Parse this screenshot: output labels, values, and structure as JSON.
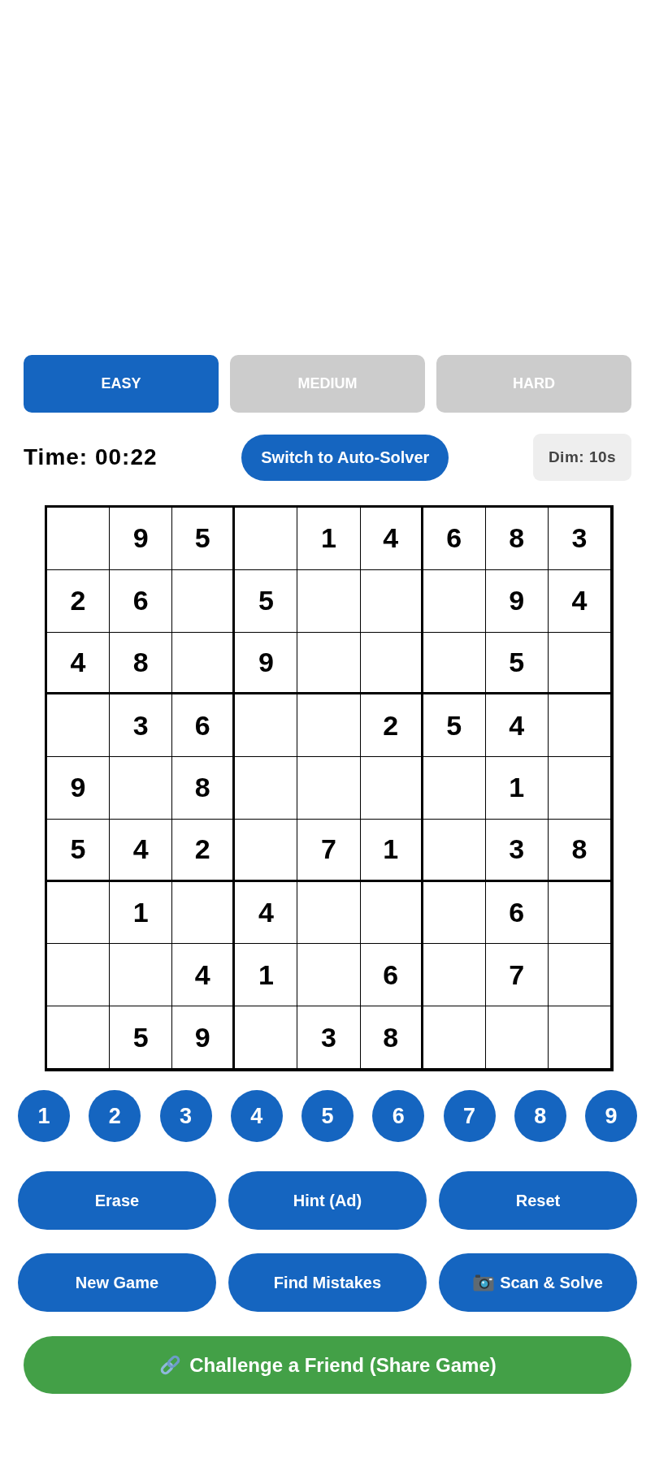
{
  "difficulty_tabs": [
    {
      "label": "EASY",
      "selected": true
    },
    {
      "label": "MEDIUM",
      "selected": false
    },
    {
      "label": "HARD",
      "selected": false
    }
  ],
  "status_row": {
    "timer": "Time: 00:22",
    "mode_button": "Switch to Auto-Solver",
    "dim_badge": "Dim: 10s"
  },
  "board": {
    "rows": [
      [
        null,
        "9",
        "5",
        null,
        "1",
        "4",
        "6",
        "8",
        "3"
      ],
      [
        "2",
        "6",
        null,
        "5",
        null,
        null,
        null,
        "9",
        "4"
      ],
      [
        "4",
        "8",
        null,
        "9",
        null,
        null,
        null,
        "5",
        null
      ],
      [
        null,
        "3",
        "6",
        null,
        null,
        "2",
        "5",
        "4",
        null
      ],
      [
        "9",
        null,
        "8",
        null,
        null,
        null,
        null,
        "1",
        null
      ],
      [
        "5",
        "4",
        "2",
        null,
        "7",
        "1",
        null,
        "3",
        "8"
      ],
      [
        null,
        "1",
        null,
        "4",
        null,
        null,
        null,
        "6",
        null
      ],
      [
        null,
        null,
        "4",
        "1",
        null,
        "6",
        null,
        "7",
        null
      ],
      [
        null,
        "5",
        "9",
        null,
        "3",
        "8",
        null,
        null,
        null
      ]
    ]
  },
  "number_pad": [
    "1",
    "2",
    "3",
    "4",
    "5",
    "6",
    "7",
    "8",
    "9"
  ],
  "actions": [
    {
      "label": "Erase",
      "kind": "plain"
    },
    {
      "label": "Hint (Ad)",
      "kind": "plain"
    },
    {
      "label": "Reset",
      "kind": "plain"
    },
    {
      "label": "New Game",
      "kind": "plain"
    },
    {
      "label": "Find Mistakes",
      "kind": "plain"
    },
    {
      "label": "Scan & Solve",
      "kind": "scan"
    }
  ],
  "share_button": {
    "label": "Challenge a Friend (Share Game)"
  }
}
